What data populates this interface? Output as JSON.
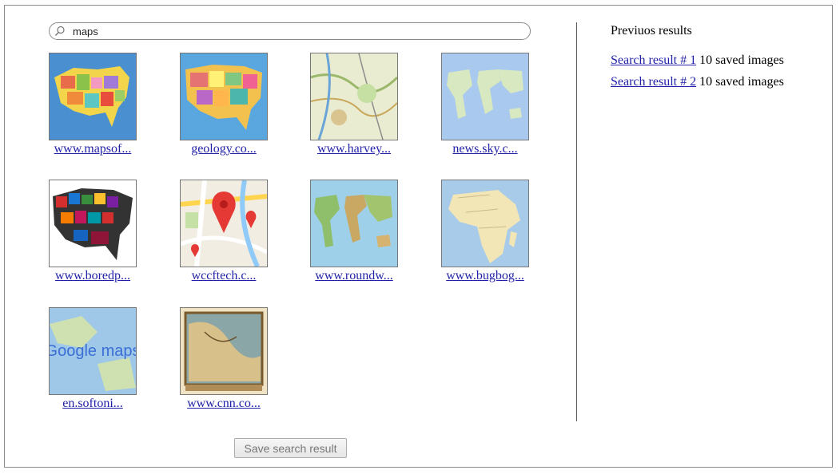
{
  "search": {
    "value": "maps"
  },
  "results": [
    {
      "link": "www.mapsof...",
      "image": "usa-states-map"
    },
    {
      "link": "geology.co...",
      "image": "usa-political-map"
    },
    {
      "link": "www.harvey...",
      "image": "topographic-map"
    },
    {
      "link": "news.sky.c...",
      "image": "world-map-light"
    },
    {
      "link": "www.boredp...",
      "image": "usa-brand-logos-map"
    },
    {
      "link": "wccftech.c...",
      "image": "map-pin-graphic"
    },
    {
      "link": "www.roundw...",
      "image": "world-physical-map"
    },
    {
      "link": "www.bugbog...",
      "image": "africa-map"
    },
    {
      "link": "en.softoni...",
      "image": "google-maps-logo",
      "logo_text": "Google maps"
    },
    {
      "link": "www.cnn.co...",
      "image": "antique-map"
    }
  ],
  "previous": {
    "title": "Previuos results",
    "items": [
      {
        "link": "Search result # 1",
        "suffix": " 10 saved images"
      },
      {
        "link": "Search result # 2",
        "suffix": " 10 saved images"
      }
    ]
  },
  "save_button": "Save search result",
  "colors": {
    "link": "#1f1fa8",
    "border": "#8a8a8a"
  }
}
